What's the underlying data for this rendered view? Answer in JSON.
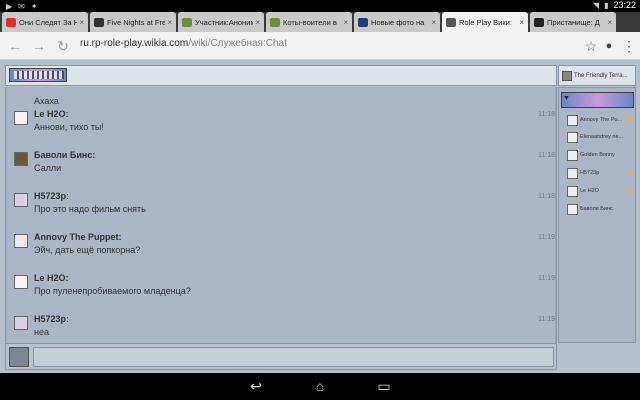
{
  "statusbar": {
    "time": "23:22",
    "left_icons": [
      "youtube",
      "mail",
      "notification"
    ]
  },
  "tabs": [
    {
      "title": "Они Следят За Н",
      "color": "#e52d27"
    },
    {
      "title": "Five Nights at Fre",
      "color": "#333333"
    },
    {
      "title": "Участник:Аноним",
      "color": "#6a8f3a"
    },
    {
      "title": "Коты-воители в",
      "color": "#6a8f3a"
    },
    {
      "title": "Новые фото на",
      "color": "#1c3e7a"
    },
    {
      "title": "Role Play Вики:",
      "color": "#555555",
      "active": true
    },
    {
      "title": "Пристанище: Д",
      "color": "#222222"
    }
  ],
  "tab_close": "×",
  "toolbar": {
    "url_host": "ru.rp-role-play.wikia.com",
    "url_path": "/wiki/Служебная:Chat"
  },
  "chat": {
    "partial_text": "Ахаха",
    "messages": [
      {
        "user": "Le H2O:",
        "text": "Аннови, тихо ты!",
        "time": "11:18"
      },
      {
        "user": "Баволи Бинс:",
        "text": "Салли",
        "time": "11:18"
      },
      {
        "user": "H5723p:",
        "text": "Про это надо фильм снять",
        "time": "11:18"
      },
      {
        "user": "Annovy The Puppet:",
        "text": "Эйч, дать ещё попкорна?",
        "time": "11:19"
      },
      {
        "user": "Le H2O:",
        "text": "Про пуленепробиваемого младенца?",
        "time": "11:19"
      },
      {
        "user": "H5723p:",
        "text": "неа",
        "time": "11:19"
      }
    ]
  },
  "sidebar": {
    "room_name": "The Friendly Terra...",
    "users": [
      {
        "name": "Annovy The Pu...",
        "star": true
      },
      {
        "name": "Elenaandrey ne...",
        "star": false
      },
      {
        "name": "Golden Bonny",
        "star": false
      },
      {
        "name": "H5723p",
        "star": true
      },
      {
        "name": "Le H2O",
        "star": true
      },
      {
        "name": "Баволи Бинс",
        "star": false
      }
    ],
    "star_glyph": "★"
  },
  "icons": {
    "back": "back-icon",
    "forward": "forward-icon",
    "reload": "reload-icon",
    "star": "bookmark-star-icon",
    "mic": "microphone-icon",
    "menu": "menu-icon"
  }
}
